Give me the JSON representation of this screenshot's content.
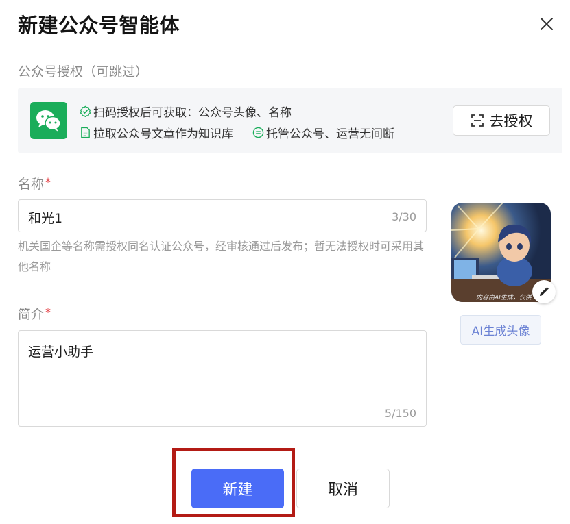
{
  "dialog": {
    "title": "新建公众号智能体"
  },
  "auth": {
    "section_label": "公众号授权（可跳过）",
    "benefit_1": "扫码授权后可获取：公众号头像、名称",
    "benefit_2": "拉取公众号文章作为知识库",
    "benefit_3": "托管公众号、运营无间断",
    "button_label": "去授权"
  },
  "name_field": {
    "label": "名称",
    "required_mark": "*",
    "value": "和光1",
    "count": "3/30",
    "hint": "机关国企等名称需授权同名认证公众号，经审核通过后发布；暂无法授权时可采用其他名称"
  },
  "intro_field": {
    "label": "简介",
    "required_mark": "*",
    "value": "运营小助手",
    "count": "5/150"
  },
  "avatar": {
    "caption": "内容由AI生成，仅供",
    "ai_button_label": "AI生成头像"
  },
  "footer": {
    "create_label": "新建",
    "cancel_label": "取消"
  },
  "colors": {
    "primary": "#4a6cf7",
    "wechat_green": "#1aad5a",
    "highlight_red": "#b31b15",
    "required_red": "#e5484d"
  }
}
